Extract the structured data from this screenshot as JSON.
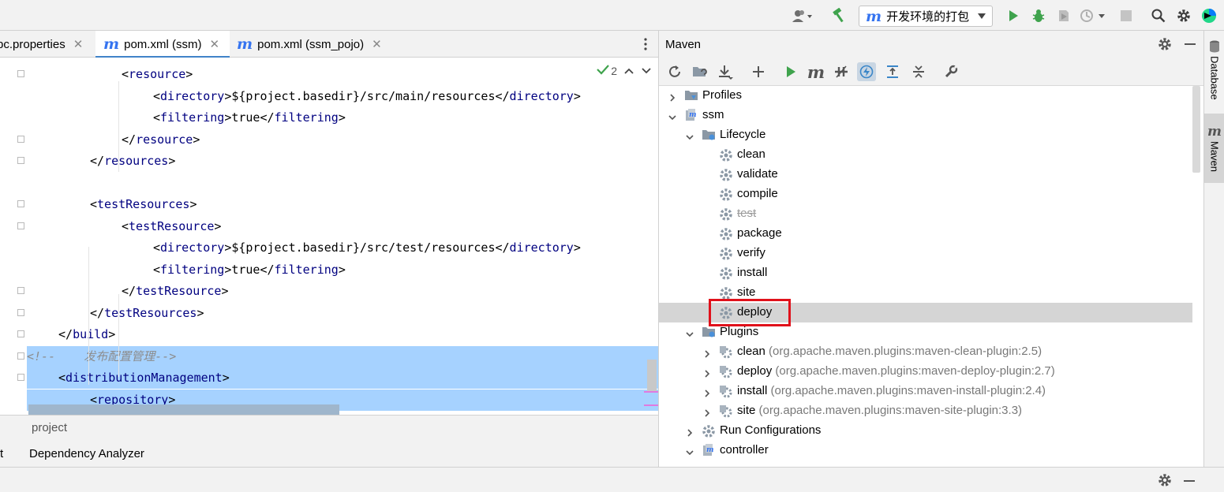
{
  "toolbar": {
    "run_config_label": "开发环境的打包",
    "icons": [
      "user-icon",
      "build-hammer-icon",
      "run-icon",
      "debug-icon",
      "coverage-icon",
      "profile-icon",
      "stop-icon",
      "search-icon",
      "settings-icon",
      "jetbrains-logo-icon"
    ]
  },
  "editor": {
    "tabs": [
      {
        "label": "pc.properties",
        "active": false
      },
      {
        "label": "pom.xml (ssm)",
        "active": true
      },
      {
        "label": "pom.xml (ssm_pojo)",
        "active": false
      }
    ],
    "inspection_count": "2",
    "lines": [
      {
        "indent": 6,
        "parts": [
          [
            "br",
            "<"
          ],
          [
            "tag",
            "resource"
          ],
          [
            "br",
            ">"
          ]
        ]
      },
      {
        "indent": 8,
        "parts": [
          [
            "br",
            "<"
          ],
          [
            "tag",
            "directory"
          ],
          [
            "br",
            ">${project.basedir}/src/main/resources</"
          ],
          [
            "tag",
            "directory"
          ],
          [
            "br",
            ">"
          ]
        ]
      },
      {
        "indent": 8,
        "parts": [
          [
            "br",
            "<"
          ],
          [
            "tag",
            "filtering"
          ],
          [
            "br",
            ">true</"
          ],
          [
            "tag",
            "filtering"
          ],
          [
            "br",
            ">"
          ]
        ]
      },
      {
        "indent": 6,
        "parts": [
          [
            "br",
            "</"
          ],
          [
            "tag",
            "resource"
          ],
          [
            "br",
            ">"
          ]
        ]
      },
      {
        "indent": 4,
        "parts": [
          [
            "br",
            "</"
          ],
          [
            "tag",
            "resources"
          ],
          [
            "br",
            ">"
          ]
        ]
      },
      {
        "indent": 0,
        "parts": []
      },
      {
        "indent": 4,
        "parts": [
          [
            "br",
            "<"
          ],
          [
            "tag",
            "testResources"
          ],
          [
            "br",
            ">"
          ]
        ]
      },
      {
        "indent": 6,
        "parts": [
          [
            "br",
            "<"
          ],
          [
            "tag",
            "testResource"
          ],
          [
            "br",
            ">"
          ]
        ]
      },
      {
        "indent": 8,
        "parts": [
          [
            "br",
            "<"
          ],
          [
            "tag",
            "directory"
          ],
          [
            "br",
            ">${project.basedir}/src/test/resources</"
          ],
          [
            "tag",
            "directory"
          ],
          [
            "br",
            ">"
          ]
        ]
      },
      {
        "indent": 8,
        "parts": [
          [
            "br",
            "<"
          ],
          [
            "tag",
            "filtering"
          ],
          [
            "br",
            ">true</"
          ],
          [
            "tag",
            "filtering"
          ],
          [
            "br",
            ">"
          ]
        ]
      },
      {
        "indent": 6,
        "parts": [
          [
            "br",
            "</"
          ],
          [
            "tag",
            "testResource"
          ],
          [
            "br",
            ">"
          ]
        ]
      },
      {
        "indent": 4,
        "parts": [
          [
            "br",
            "</"
          ],
          [
            "tag",
            "testResources"
          ],
          [
            "br",
            ">"
          ]
        ]
      },
      {
        "indent": 2,
        "parts": [
          [
            "br",
            "</"
          ],
          [
            "tag",
            "build"
          ],
          [
            "br",
            ">"
          ]
        ]
      },
      {
        "indent": 0,
        "parts": [
          [
            "cmt",
            "<!--    发布配置管理-->"
          ]
        ],
        "selected": true
      },
      {
        "indent": 2,
        "parts": [
          [
            "br",
            "<"
          ],
          [
            "tag",
            "distributionManagement"
          ],
          [
            "br",
            ">"
          ]
        ],
        "selected": true
      },
      {
        "indent": 4,
        "parts": [
          [
            "br",
            "<"
          ],
          [
            "tag",
            "repository"
          ],
          [
            "br",
            ">"
          ]
        ],
        "selected": true
      }
    ]
  },
  "bottom_left": {
    "item1": "project",
    "item2_prefix": "t",
    "item2": "Dependency Analyzer"
  },
  "maven": {
    "title": "Maven",
    "tree": [
      {
        "level": 0,
        "chevron": "right",
        "icon": "folder-profiles-icon",
        "label": "Profiles",
        "sub": ""
      },
      {
        "level": 0,
        "chevron": "down",
        "icon": "maven-module-icon",
        "label": "ssm",
        "sub": ""
      },
      {
        "level": 1,
        "chevron": "down",
        "icon": "lifecycle-folder-icon",
        "label": "Lifecycle",
        "sub": ""
      },
      {
        "level": 2,
        "chevron": "",
        "icon": "gear-icon",
        "label": "clean",
        "sub": ""
      },
      {
        "level": 2,
        "chevron": "",
        "icon": "gear-icon",
        "label": "validate",
        "sub": ""
      },
      {
        "level": 2,
        "chevron": "",
        "icon": "gear-icon",
        "label": "compile",
        "sub": ""
      },
      {
        "level": 2,
        "chevron": "",
        "icon": "gear-icon",
        "label": "test",
        "sub": "",
        "strike": true
      },
      {
        "level": 2,
        "chevron": "",
        "icon": "gear-icon",
        "label": "package",
        "sub": ""
      },
      {
        "level": 2,
        "chevron": "",
        "icon": "gear-icon",
        "label": "verify",
        "sub": ""
      },
      {
        "level": 2,
        "chevron": "",
        "icon": "gear-icon",
        "label": "install",
        "sub": ""
      },
      {
        "level": 2,
        "chevron": "",
        "icon": "gear-icon",
        "label": "site",
        "sub": ""
      },
      {
        "level": 2,
        "chevron": "",
        "icon": "gear-icon",
        "label": "deploy",
        "sub": "",
        "selected": true
      },
      {
        "level": 1,
        "chevron": "down",
        "icon": "plugins-folder-icon",
        "label": "Plugins",
        "sub": ""
      },
      {
        "level": 2,
        "chevron": "right",
        "icon": "plugin-icon",
        "label": "clean",
        "sub": " (org.apache.maven.plugins:maven-clean-plugin:2.5)"
      },
      {
        "level": 2,
        "chevron": "right",
        "icon": "plugin-icon",
        "label": "deploy",
        "sub": " (org.apache.maven.plugins:maven-deploy-plugin:2.7)"
      },
      {
        "level": 2,
        "chevron": "right",
        "icon": "plugin-icon",
        "label": "install",
        "sub": " (org.apache.maven.plugins:maven-install-plugin:2.4)"
      },
      {
        "level": 2,
        "chevron": "right",
        "icon": "plugin-icon",
        "label": "site",
        "sub": " (org.apache.maven.plugins:maven-site-plugin:3.3)"
      },
      {
        "level": 1,
        "chevron": "right",
        "icon": "run-config-folder-icon",
        "label": "Run Configurations",
        "sub": ""
      },
      {
        "level": 1,
        "chevron": "down",
        "icon": "maven-module-icon",
        "label": "controller",
        "sub": ""
      }
    ]
  },
  "side_tabs": {
    "database": "Database",
    "maven": "Maven"
  },
  "colors": {
    "accent": "#4083c9",
    "selection": "#a6d2ff",
    "highlight_box": "#e0111b",
    "run_green": "#3fa34d"
  }
}
